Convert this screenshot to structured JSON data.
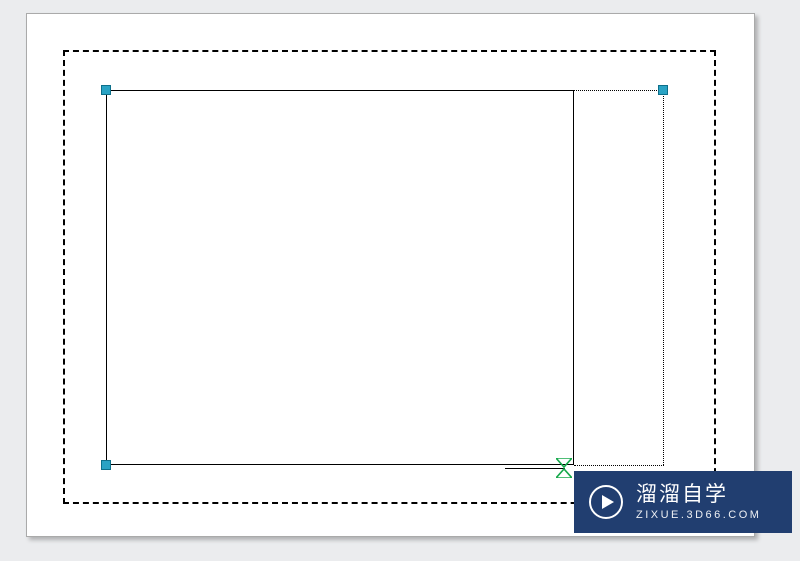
{
  "watermark": {
    "title": "溜溜自学",
    "url": "ZIXUE.3D66.COM",
    "icon_name": "play-circle-icon"
  },
  "canvas": {
    "paper_bg": "#ffffff",
    "stage_bg": "#ebecee"
  },
  "layout_rect": {
    "dash_border": "dashed",
    "color": "#000000"
  },
  "viewport_rect": {
    "border_style": "solid",
    "color": "#000000"
  },
  "selection": {
    "grip_color": "#2aa3c4",
    "grip_border": "#0d6f8a",
    "marquee_style": "dotted"
  },
  "marker": {
    "color": "#15a84a",
    "shape": "hourglass-triangles"
  }
}
